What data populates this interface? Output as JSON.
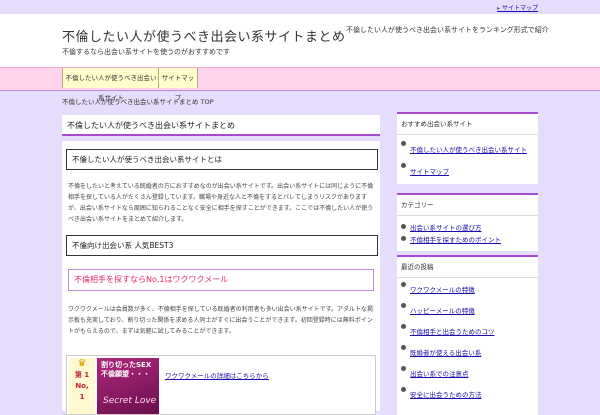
{
  "toplink": "サイトマップ",
  "header": {
    "title": "不倫したい人が使うべき出会い系サイトまとめ",
    "description": "不倫するなら出会い系サイトを使うのがおすすめです",
    "right_text": "不倫したい人が使うべき出会い系サイトをランキング形式で紹介"
  },
  "nav": [
    {
      "label": "不倫したい人が使うべき出会い系サイト"
    },
    {
      "label": "サイトマップ"
    }
  ],
  "breadcrumb": "不倫したい人が使うべき出会い系サイトまとめ TOP",
  "main": {
    "page_title": "不倫したい人が使うべき出会い系サイトまとめ",
    "section1_heading": "不倫したい人が使うべき出会い系サイトとは",
    "section1_text": "不倫をしたいと考えている既婚者の方におすすめなのが出会い系サイトです。出会い系サイトには同じように不倫相手を探している人がたくさん登録しています。職場や身近な人と不倫をするとバレてしまうリスクがありますが、出会い系サイトなら周囲に知られることなく安全に相手を探すことができます。ここでは不倫したい人が使うべき出会い系サイトをまとめて紹介します。",
    "section2_heading": "不倫向け出会い系 人気BEST3",
    "section3_heading": "不倫相手を探すならNo,1はワクワクメール",
    "section3_text": "ワクワクメールは会員数が多く、不倫相手を探している既婚者の利用者も多い出会い系サイトです。アダルトな掲示板も充実しており、割り切った関係を求める人同士がすぐに出会うことができます。初回登録時には無料ポイントがもらえるので、まずは気軽に試してみることができます。",
    "ranking": {
      "crown": "♛",
      "label": "第 1\nNo,\n1",
      "banner_title": "割り切ったSEX\n不倫願望・・・",
      "banner_script": "Secret Love",
      "link": "ワクワクメールの詳細はこちらから"
    }
  },
  "sidebar": {
    "widgets": [
      {
        "title": "おすすめ出会い系サイト",
        "items": [
          "不倫したい人が使うべき出会い系サイト",
          "サイトマップ"
        ]
      },
      {
        "title": "カテゴリー",
        "items": [
          "出会い系サイトの選び方",
          "不倫相手を探すためのポイント"
        ]
      },
      {
        "title": "最近の投稿",
        "items": [
          "ワクワクメールの特徴",
          "ハッピーメールの特徴",
          "不倫相手と出会うためのコツ",
          "既婚者が使える出会い系",
          "出会い系での注意点",
          "安全に出会うための方法"
        ]
      }
    ]
  }
}
